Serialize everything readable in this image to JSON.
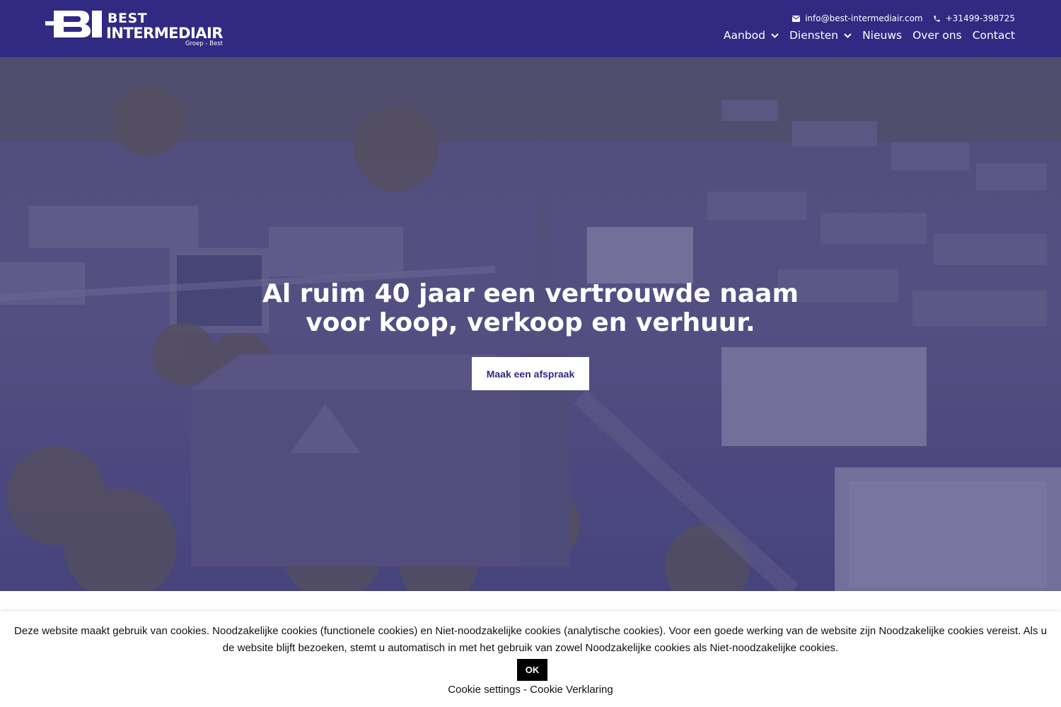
{
  "header": {
    "logo": {
      "line1": "BEST",
      "line2": "INTERMEDIAIR",
      "tagline": "Groep - Best",
      "monogram": "BI"
    },
    "contact": {
      "email": "info@best-intermediair.com",
      "email_icon": "envelope-icon",
      "phone": "+31499-398725",
      "phone_icon": "phone-icon"
    },
    "nav": [
      {
        "label": "Aanbod",
        "has_dropdown": true
      },
      {
        "label": "Diensten",
        "has_dropdown": true
      },
      {
        "label": "Nieuws",
        "has_dropdown": false
      },
      {
        "label": "Over ons",
        "has_dropdown": false
      },
      {
        "label": "Contact",
        "has_dropdown": false
      }
    ]
  },
  "hero": {
    "title_line1": "Al ruim 40 jaar een vertrouwde naam",
    "title_line2": "voor koop, verkoop en verhuur.",
    "button_label": "Maak een afspraak"
  },
  "cookie": {
    "text": "Deze website maakt gebruik van cookies. Noodzakelijke cookies (functionele cookies) en Niet-noodzakelijke cookies (analytische cookies). Voor een goede werking van de website zijn Noodzakelijke cookies vereist. Als u de website blijft bezoeken, stemt u automatisch in met het gebruik van zowel Noodzakelijke cookies als Niet-noodzakelijke cookies.",
    "ok_label": "OK",
    "settings_label": "Cookie settings",
    "separator": " - ",
    "statement_label": "Cookie Verklaring"
  },
  "colors": {
    "brand": "#302a83",
    "white": "#ffffff",
    "cookie_button": "#000000"
  }
}
